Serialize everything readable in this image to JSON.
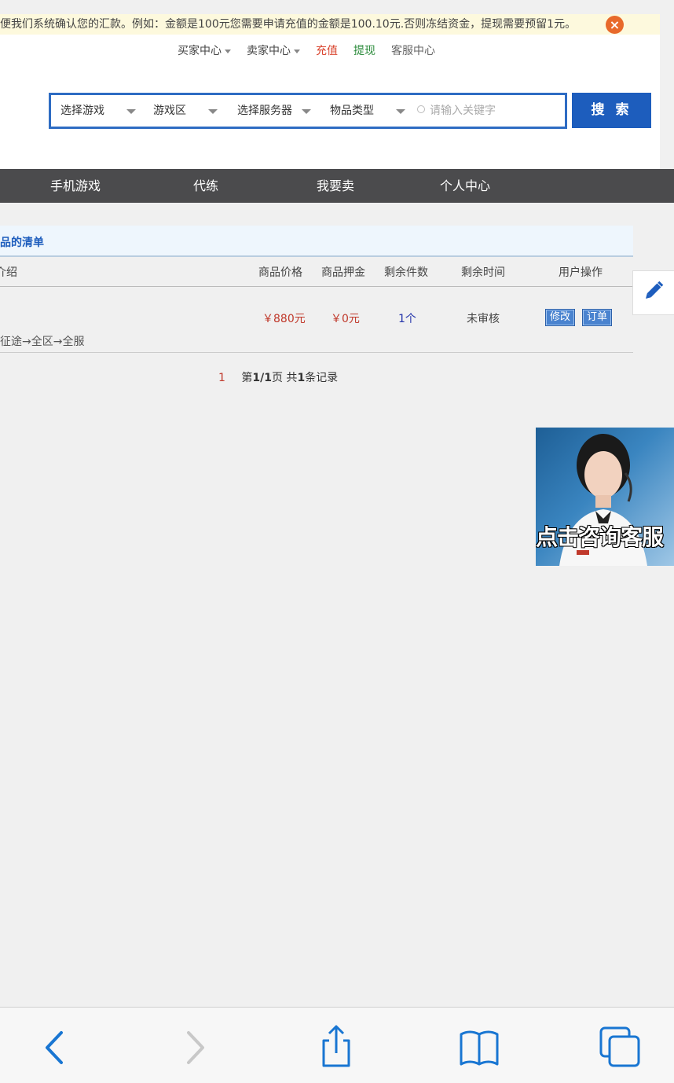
{
  "notice": {
    "text": "便我们系统确认您的汇款。例如：金额是100元您需要申请充值的金额是100.10元.否则冻结资金，提现需要预留1元。",
    "close_symbol": "×"
  },
  "topnav": {
    "buyer_center": "买家中心",
    "seller_center": "卖家中心",
    "recharge": "充值",
    "withdraw": "提现",
    "customer_service": "客服中心"
  },
  "search": {
    "game": "选择游戏",
    "zone": "游戏区",
    "server": "选择服务器",
    "item_type": "物品类型",
    "placeholder": "请输入关键字",
    "button": "搜 索"
  },
  "mainnav": {
    "items": [
      "手机游戏",
      "代练",
      "我要卖",
      "个人中心"
    ]
  },
  "listing": {
    "title": "品的清单",
    "headers": {
      "intro": "介绍",
      "price": "商品价格",
      "deposit": "商品押金",
      "remaining_count": "剩余件数",
      "remaining_time": "剩余时间",
      "actions": "用户操作"
    },
    "rows": [
      {
        "path": "征途→全区→全服",
        "price": "￥880元",
        "deposit": "￥0元",
        "count": "1个",
        "time": "未审核",
        "edit": "修改",
        "order": "订单"
      }
    ],
    "pager": {
      "current": "1",
      "label_prefix": "第",
      "page": "1/1",
      "label_mid": "页 共",
      "total": "1",
      "label_suffix": "条记录"
    }
  },
  "service_banner": {
    "text": "点击咨询客服"
  },
  "colors": {
    "accent_blue": "#1d5dbd",
    "price_red": "#c0392b",
    "recharge_red": "#d9442e",
    "withdraw_green": "#2a8a3a",
    "count_blue": "#2233aa",
    "nav_bg": "#4b4b4d"
  }
}
